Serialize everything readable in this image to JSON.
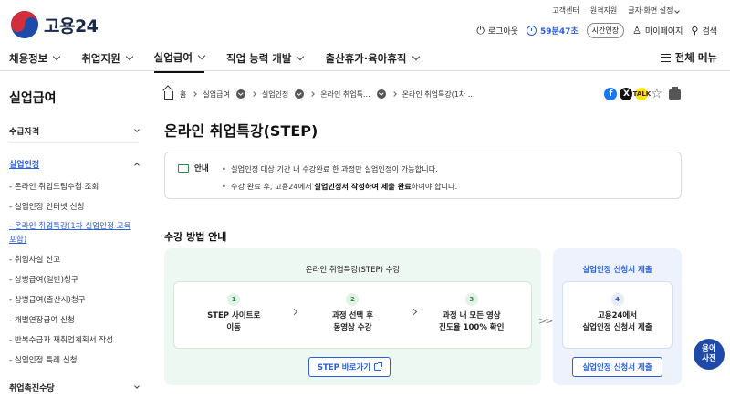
{
  "utility": [
    "고객센터",
    "원격지원",
    "글자·화면 설정"
  ],
  "brand": {
    "name": "고용24"
  },
  "user_bar": {
    "logout": "로그아웃",
    "timer": "59분47초",
    "extend": "시간연장",
    "mypage": "마이페이지",
    "search": "검색"
  },
  "gnb": {
    "items": [
      "채용정보",
      "취업지원",
      "실업급여",
      "직업 능력 개발",
      "출산휴가·육아휴직"
    ],
    "active": "실업급여",
    "all_menu": "전체 메뉴"
  },
  "sidebar": {
    "title": "실업급여",
    "sec1": "수급자격",
    "sec2": "실업인정",
    "items": [
      "- 온라인 취업드림수첩 조회",
      "- 실업인정 인터넷 신청",
      "- 온라인 취업특강(1차 실업인정 교육 포함)",
      "- 취업사실 신고",
      "- 상병급여(일반)청구",
      "- 상병급여(출산시)청구",
      "- 개별연장급여 신청",
      "- 반복수급자 재취업계획서 작성",
      "- 실업인정 특례 신청"
    ],
    "sec3": "취업촉진수당"
  },
  "breadcrumb": [
    "홈",
    "실업급여",
    "실업인정",
    "온라인 취업특...",
    "온라인 취업특강(1차 ..."
  ],
  "page_title": "온라인 취업특강(STEP)",
  "notice": {
    "label": "안내",
    "line1": "실업인정 대상 기간 내 수강완료 한 과정만 실업인정이 가능합니다.",
    "line2_a": "수강 완료 후, 고용24에서 ",
    "line2_b": "실업인정서 작성하여 제출 완료",
    "line2_c": "하여야 합니다."
  },
  "section_title": "수강 방법 안내",
  "process_left": {
    "header": "온라인 취업특강(STEP) 수강",
    "steps": [
      {
        "num": "1",
        "line1": "STEP 사이트로",
        "line2": "이동"
      },
      {
        "num": "2",
        "line1": "과정 선택 후",
        "line2": "동영상 수강"
      },
      {
        "num": "3",
        "line1": "과정 내 모든 영상",
        "line2": "진도율 100% 확인"
      }
    ],
    "button": "STEP 바로가기"
  },
  "process_right": {
    "header": "실업인정 신청서 제출",
    "step": {
      "num": "4",
      "line1": "고용24에서",
      "line2": "실업인정 신청서 제출"
    },
    "button": "실업인정 신청서 제출"
  },
  "dictionary": {
    "line1": "용어",
    "line2": "사전"
  },
  "colors": {
    "accent": "#2b5fd9",
    "green_bg": "#eef8f2",
    "blue_bg": "#edf2fd"
  }
}
